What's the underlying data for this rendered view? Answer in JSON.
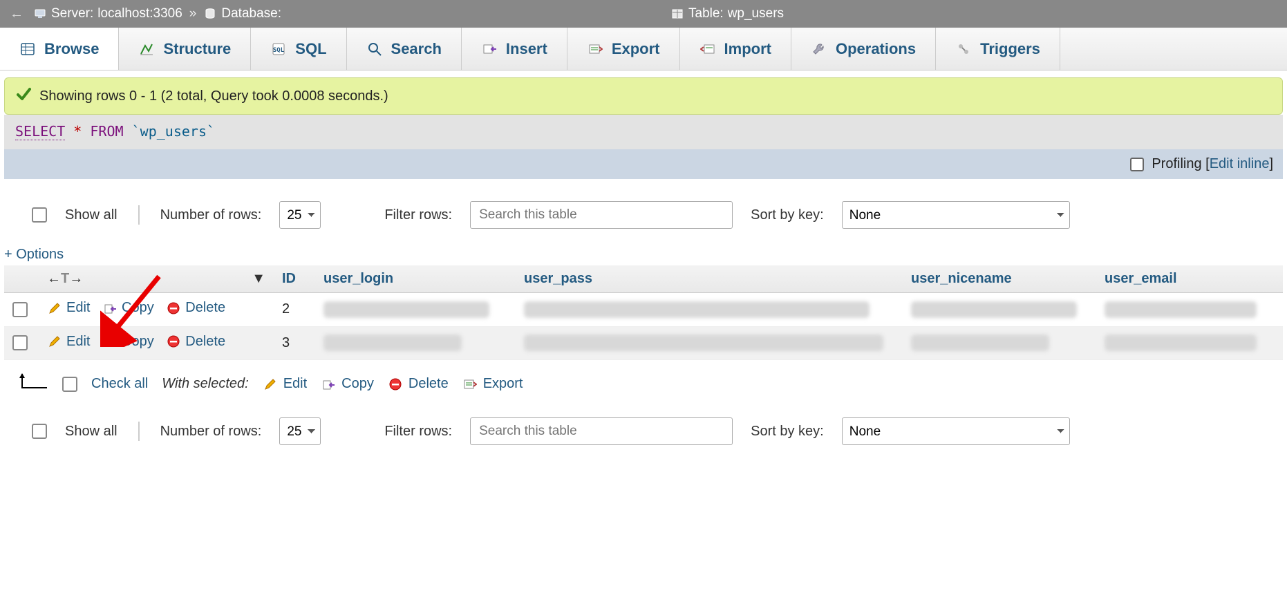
{
  "breadcrumb": {
    "server_label": "Server:",
    "server_value": "localhost:3306",
    "database_label": "Database:",
    "database_value": "",
    "table_label": "Table:",
    "table_value": "wp_users"
  },
  "tabs": {
    "browse": "Browse",
    "structure": "Structure",
    "sql": "SQL",
    "search": "Search",
    "insert": "Insert",
    "export": "Export",
    "import": "Import",
    "operations": "Operations",
    "triggers": "Triggers"
  },
  "success_msg": "Showing rows 0 - 1 (2 total, Query took 0.0008 seconds.)",
  "sql": {
    "select": "SELECT",
    "star": "*",
    "from": "FROM",
    "table": "`wp_users`"
  },
  "sql_footer": {
    "profiling": "Profiling",
    "edit_inline": "Edit inline"
  },
  "controls": {
    "show_all": "Show all",
    "num_rows_label": "Number of rows:",
    "num_rows_value": "25",
    "filter_label": "Filter rows:",
    "filter_placeholder": "Search this table",
    "sort_label": "Sort by key:",
    "sort_value": "None"
  },
  "options_link": "+ Options",
  "columns": {
    "id": "ID",
    "user_login": "user_login",
    "user_pass": "user_pass",
    "user_nicename": "user_nicename",
    "user_email": "user_email"
  },
  "row_actions": {
    "edit": "Edit",
    "copy": "Copy",
    "delete": "Delete"
  },
  "rows": [
    {
      "id": "2"
    },
    {
      "id": "3"
    }
  ],
  "bulk": {
    "check_all": "Check all",
    "with_selected": "With selected:",
    "edit": "Edit",
    "copy": "Copy",
    "delete": "Delete",
    "export": "Export"
  }
}
